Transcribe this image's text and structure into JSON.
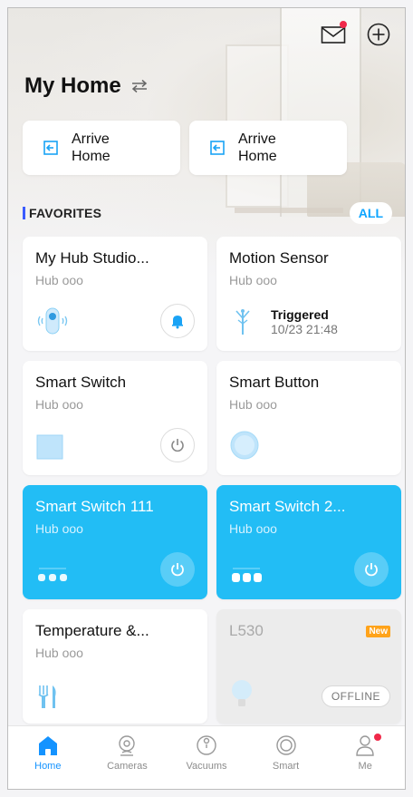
{
  "header": {
    "home_name": "My Home"
  },
  "scenes": [
    {
      "label_line1": "Arrive",
      "label_line2": "Home"
    },
    {
      "label_line1": "Arrive",
      "label_line2": "Home"
    }
  ],
  "favorites": {
    "title": "FAVORITES",
    "all_label": "ALL"
  },
  "cards": [
    {
      "name": "My Hub Studio...",
      "sub": "Hub ooo"
    },
    {
      "name": "Motion Sensor",
      "sub": "Hub ooo",
      "status_line1": "Triggered",
      "status_line2": "10/23 21:48"
    },
    {
      "name": "Smart Switch",
      "sub": "Hub ooo"
    },
    {
      "name": "Smart Button",
      "sub": "Hub ooo"
    },
    {
      "name": "Smart Switch 111",
      "sub": "Hub ooo"
    },
    {
      "name": "Smart Switch 2...",
      "sub": "Hub ooo"
    },
    {
      "name": "Temperature &...",
      "sub": "Hub ooo"
    },
    {
      "name": "L530",
      "sub": "",
      "badge": "New",
      "status": "OFFLINE"
    }
  ],
  "tabs": [
    {
      "label": "Home"
    },
    {
      "label": "Cameras"
    },
    {
      "label": "Vacuums"
    },
    {
      "label": "Smart"
    },
    {
      "label": "Me"
    }
  ],
  "colors": {
    "accent": "#22bdf5",
    "tab_active": "#1493ff",
    "notification_dot": "#f02849",
    "new_badge": "#ffa31a"
  }
}
